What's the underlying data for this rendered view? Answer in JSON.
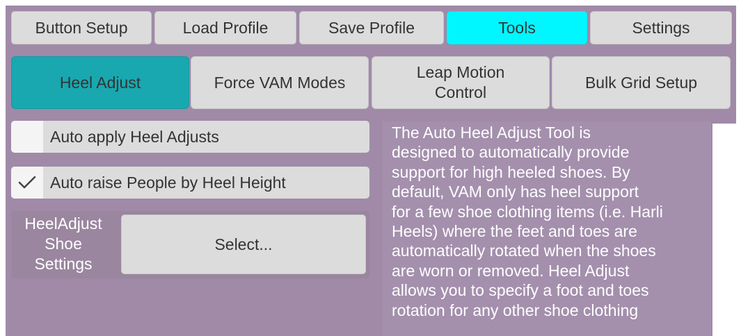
{
  "tabs": [
    {
      "label": "Button Setup",
      "active": false
    },
    {
      "label": "Load Profile",
      "active": false
    },
    {
      "label": "Save Profile",
      "active": false
    },
    {
      "label": "Tools",
      "active": true
    },
    {
      "label": "Settings",
      "active": false
    }
  ],
  "subtabs": [
    {
      "label": "Heel Adjust",
      "active": true
    },
    {
      "label": "Force VAM Modes",
      "active": false
    },
    {
      "label_line1": "Leap Motion",
      "label_line2": "Control",
      "active": false
    },
    {
      "label": "Bulk Grid Setup",
      "active": false
    }
  ],
  "options": {
    "auto_apply": {
      "label": "Auto apply Heel Adjusts",
      "checked": false
    },
    "auto_raise": {
      "label": "Auto raise People by Heel Height",
      "checked": true
    }
  },
  "shoe_settings": {
    "label_line1": "HeelAdjust",
    "label_line2": "Shoe",
    "label_line3": "Settings",
    "select_label": "Select..."
  },
  "description": {
    "lines": [
      "The Auto Heel Adjust Tool is",
      "designed to automatically provide",
      "support for high heeled shoes. By",
      "default, VAM only has heel support",
      "for a few shoe clothing items (i.e. Harli",
      "Heels) where the feet and toes are",
      "automatically rotated when the shoes",
      "are worn or removed. Heel Adjust",
      "allows you to specify a foot and toes",
      "rotation for any other shoe clothing"
    ]
  },
  "colors": {
    "panel_bg": "#a08aa8",
    "tab_active": "#00f7ff",
    "subtab_active": "#19a8b0",
    "button_bg": "#dcdcdc"
  }
}
